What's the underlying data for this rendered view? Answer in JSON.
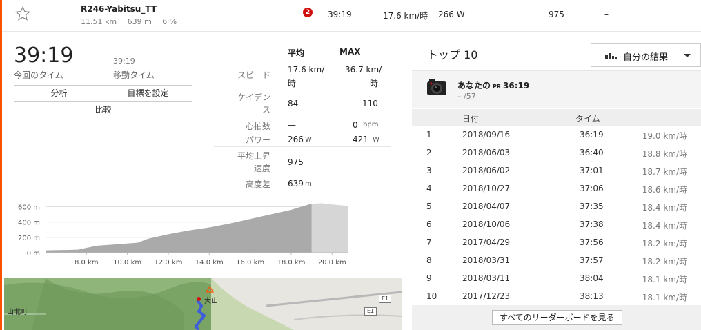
{
  "segment": {
    "name": "R246-Yabitsu_TT",
    "distance": "11.51 km",
    "elev": "639 m",
    "grade": "6 %",
    "badge": "2",
    "time": "39:19",
    "speed": "17.6 km/時",
    "power": "266 W",
    "elev_gain": "975",
    "dash": "–"
  },
  "summary": {
    "time": "39:19",
    "time_label": "今回のタイム",
    "moving_time": "39:19",
    "moving_label": "移動タイム",
    "buttons": {
      "analyze": "分析",
      "goal": "目標を設定",
      "compare": "比較"
    }
  },
  "stats": {
    "avg_header": "平均",
    "max_header": "MAX",
    "rows": {
      "speed": {
        "label": "スピード",
        "avg": "17.6 km/",
        "avg2": "時",
        "max": "36.7 km/",
        "max2": "時"
      },
      "cadence": {
        "label1": "ケイデン",
        "label2": "ス",
        "avg": "84",
        "max": "110"
      },
      "hr": {
        "label": "心拍数",
        "avg": "—",
        "max": "0",
        "unit": "bpm"
      },
      "power": {
        "label": "パワー",
        "avg": "266",
        "max": "421",
        "unit": "W"
      },
      "vam": {
        "label1": "平均上昇",
        "label2": "速度",
        "avg": "975"
      },
      "elev": {
        "label": "高度差",
        "avg": "639",
        "unit": "m"
      }
    }
  },
  "chart_data": {
    "type": "area",
    "title": "",
    "xlabel": "",
    "ylabel": "",
    "x_ticks": [
      "8.0 km",
      "10.0 km",
      "12.0 km",
      "14.0 km",
      "16.0 km",
      "18.0 km",
      "20.0 km"
    ],
    "y_ticks": [
      "600 m",
      "400 m",
      "200 m",
      "0 m"
    ],
    "xlim": [
      6.0,
      20.8
    ],
    "ylim": [
      0,
      650
    ],
    "highlight_end_km": 19.0,
    "series": [
      {
        "x": [
          6.0,
          7.0,
          7.6,
          8.5,
          9.5,
          10.5,
          11.0,
          12.0,
          13.0,
          14.0,
          15.0,
          16.0,
          17.0,
          18.0,
          18.5,
          19.0,
          19.5,
          20.0,
          20.8
        ],
        "y": [
          30,
          35,
          40,
          90,
          110,
          130,
          180,
          240,
          290,
          330,
          380,
          440,
          500,
          560,
          600,
          640,
          645,
          630,
          610
        ]
      }
    ],
    "colors": {
      "fill": "#aaaaaa",
      "dim_fill": "#d6d6d6"
    }
  },
  "map": {
    "labels": [
      "山北町",
      "大山"
    ],
    "roads": [
      "E1",
      "E1"
    ]
  },
  "right": {
    "title": "トップ 10",
    "dropdown": "自分の結果",
    "you": {
      "name": "あなたの",
      "pr": "PR",
      "time": "36:19",
      "rank": "– /57"
    },
    "headers": {
      "date": "日付",
      "time": "タイム"
    },
    "rows": [
      {
        "rank": "1",
        "date": "2018/09/16",
        "time": "36:19",
        "speed": "19.0 km/時"
      },
      {
        "rank": "2",
        "date": "2018/06/03",
        "time": "36:40",
        "speed": "18.8 km/時"
      },
      {
        "rank": "3",
        "date": "2018/06/02",
        "time": "37:01",
        "speed": "18.7 km/時"
      },
      {
        "rank": "4",
        "date": "2018/10/27",
        "time": "37:06",
        "speed": "18.6 km/時"
      },
      {
        "rank": "5",
        "date": "2018/04/07",
        "time": "37:35",
        "speed": "18.4 km/時"
      },
      {
        "rank": "6",
        "date": "2018/10/06",
        "time": "37:38",
        "speed": "18.4 km/時"
      },
      {
        "rank": "7",
        "date": "2017/04/29",
        "time": "37:56",
        "speed": "18.2 km/時"
      },
      {
        "rank": "8",
        "date": "2018/03/31",
        "time": "37:57",
        "speed": "18.2 km/時"
      },
      {
        "rank": "9",
        "date": "2018/03/11",
        "time": "38:04",
        "speed": "18.1 km/時"
      },
      {
        "rank": "10",
        "date": "2017/12/23",
        "time": "38:13",
        "speed": "18.1 km/時"
      }
    ],
    "footer_button": "すべてのリーダーボードを見る"
  }
}
